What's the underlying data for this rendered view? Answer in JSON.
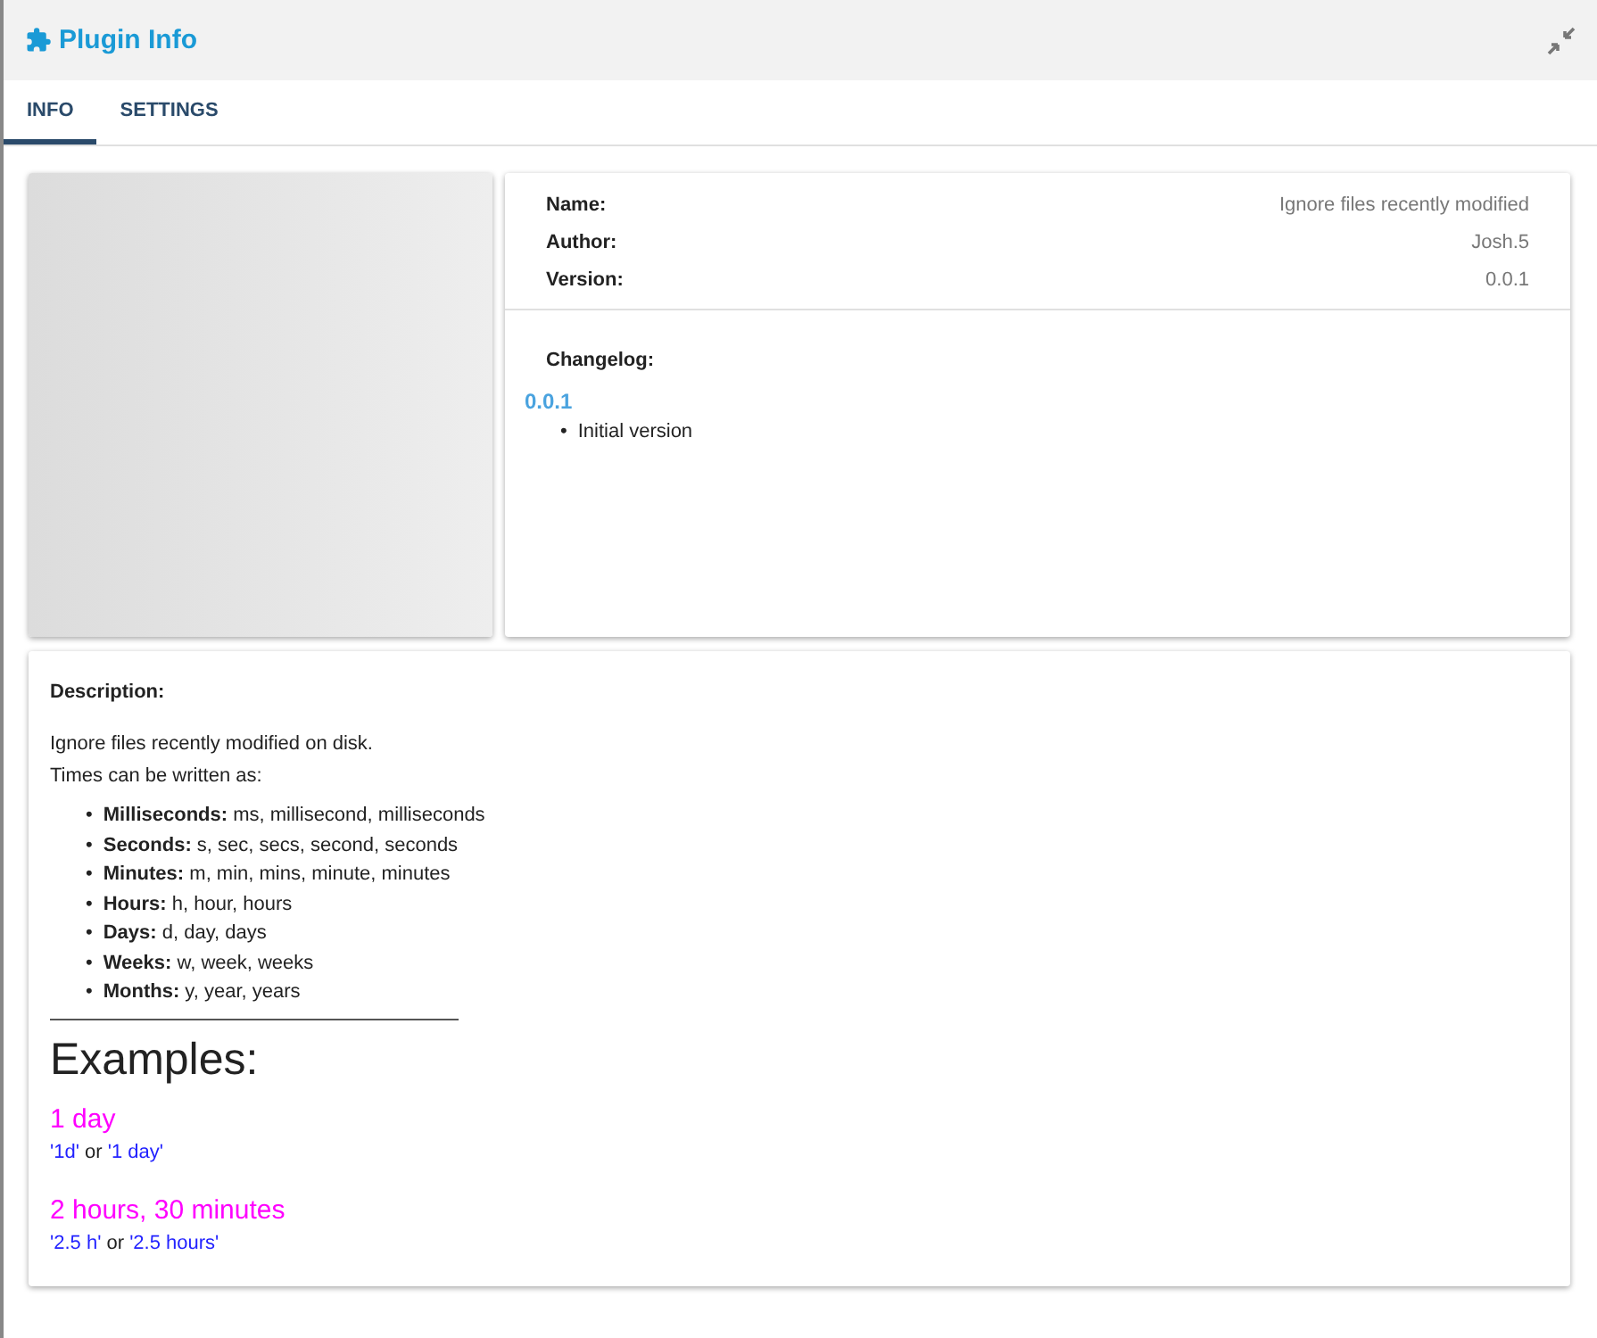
{
  "window": {
    "title": "Plugin Info"
  },
  "tabs": [
    {
      "label": "INFO",
      "selected": true
    },
    {
      "label": "SETTINGS",
      "selected": false
    }
  ],
  "info": {
    "fields": [
      {
        "label": "Name:",
        "value": "Ignore files recently modified"
      },
      {
        "label": "Author:",
        "value": "Josh.5"
      },
      {
        "label": "Version:",
        "value": "0.0.1"
      }
    ],
    "changelog_label": "Changelog:",
    "changelog": [
      {
        "version": "0.0.1",
        "bullet": "•",
        "items": [
          "Initial version"
        ]
      }
    ]
  },
  "description": {
    "label": "Description:",
    "paragraphs": [
      "Ignore files recently modified on disk.",
      "Times can be written as:"
    ],
    "bullet": "•",
    "units": [
      "**Milliseconds:** ms, millisecond, milliseconds",
      "**Seconds:** s, sec, secs, second, seconds",
      "**Minutes:** m, min, mins, minute, minutes",
      "**Hours:** h, hour, hours",
      "**Days:** d, day, days",
      "**Weeks:** w, week, weeks",
      "**Months:** y, year, years"
    ],
    "examples_heading": "Examples:",
    "examples": [
      {
        "title": "1 day",
        "forms": [
          "'1d'",
          "'1 day'"
        ],
        "joiner": "or"
      },
      {
        "title": "2 hours, 30 minutes",
        "forms": [
          "'2.5 h'",
          "'2.5 hours'"
        ],
        "joiner": "or"
      }
    ]
  }
}
